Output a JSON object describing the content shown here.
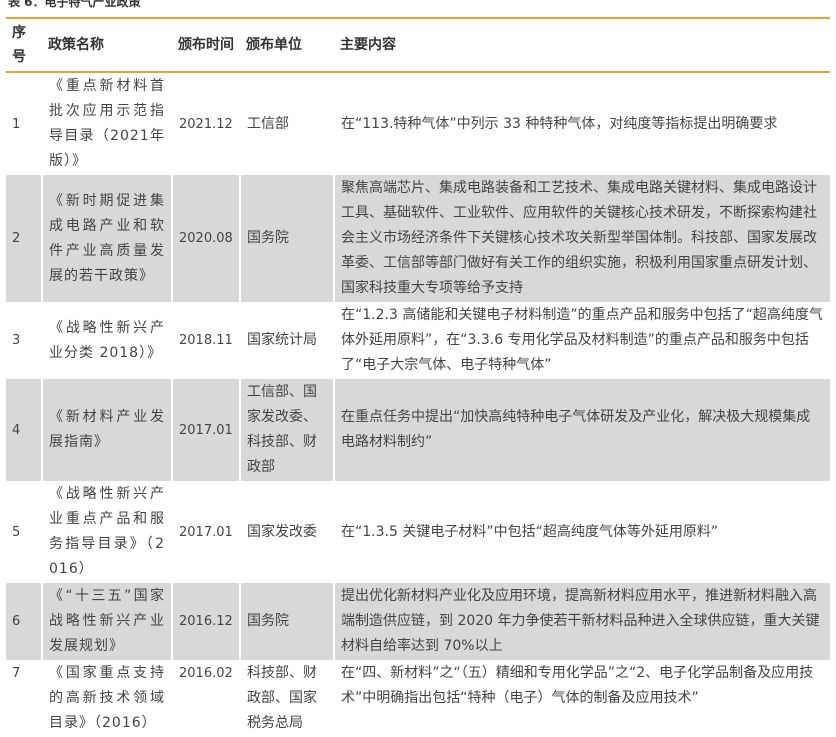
{
  "caption": "表 6：电子特气产业政策",
  "headers": {
    "num": "序号",
    "name": "政策名称",
    "date": "颁布时间",
    "issuer": "颁布单位",
    "content": "主要内容"
  },
  "rows": [
    {
      "num": "1",
      "name": "《重点新材料首批次应用示范指导目录（2021年版）》",
      "date": "2021.12",
      "issuer": "工信部",
      "content": "在“113.特种气体”中列示 33 种特种气体，对纯度等指标提出明确要求"
    },
    {
      "num": "2",
      "name": "《新时期促进集成电路产业和软件产业高质量发展的若干政策》",
      "date": "2020.08",
      "issuer": "国务院",
      "content": "聚焦高端芯片、集成电路装备和工艺技术、集成电路关键材料、集成电路设计工具、基础软件、工业软件、应用软件的关键核心技术研发，不断探索构建社会主义市场经济条件下关键核心技术攻关新型举国体制。科技部、国家发展改革委、工信部等部门做好有关工作的组织实施，积极利用国家重点研发计划、国家科技重大专项等给予支持"
    },
    {
      "num": "3",
      "name": "《战略性新兴产业分类 2018）》",
      "date": "2018.11",
      "issuer": "国家统计局",
      "content": "在“1.2.3 高储能和关键电子材料制造”的重点产品和服务中包括了“超高纯度气体外延用原料”，在“3.3.6 专用化学品及材料制造”的重点产品和服务中包括了“电子大宗气体、电子特种气体”"
    },
    {
      "num": "4",
      "name": "《新材料产业发展指南》",
      "date": "2017.01",
      "issuer": "工信部、国家发改委、科技部、财政部",
      "content": "在重点任务中提出“加快高纯特种电子气体研发及产业化，解决极大规模集成电路材料制约”"
    },
    {
      "num": "5",
      "name": "《战略性新兴产业重点产品和服务指导目录》（2016）",
      "date": "2017.01",
      "issuer": "国家发改委",
      "content": "在“1.3.5 关键电子材料”中包括“超高纯度气体等外延用原料”"
    },
    {
      "num": "6",
      "name": "《“十三五”国家战略性新兴产业发展规划》",
      "date": "2016.12",
      "issuer": "国务院",
      "content": "提出优化新材料产业化及应用环境，提高新材料应用水平，推进新材料融入高端制造供应链，到 2020 年力争使若干新材料品种进入全球供应链，重大关键材料自给率达到 70%以上"
    },
    {
      "num": "7",
      "name": "《国家重点支持的高新技术领域目录》（2016）",
      "date": "2016.02",
      "issuer": "科技部、财政部、国家税务总局",
      "content": "在“四、新材料”之“（五）精细和专用化学品”之“2、电子化学品制备及应用技术”中明确指出包括“特种（电子）气体的制备及应用技术”"
    }
  ]
}
